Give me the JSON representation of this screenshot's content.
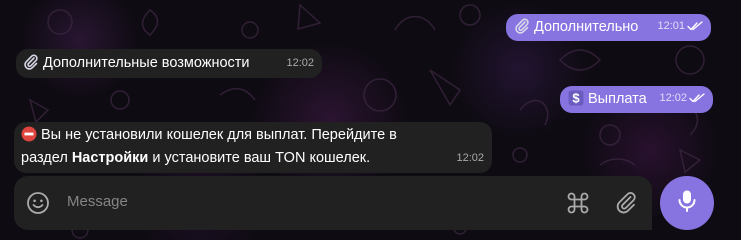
{
  "messages": [
    {
      "id": "m1",
      "direction": "outgoing",
      "icon": "paperclip-emoji-icon",
      "text": "Дополнительно",
      "time": "12:01",
      "read": true
    },
    {
      "id": "m2",
      "direction": "incoming",
      "icon": "paperclip-emoji-icon",
      "text": "Дополнительные возможности",
      "time": "12:02"
    },
    {
      "id": "m3",
      "direction": "outgoing",
      "icon": "dollar-emoji-icon",
      "text": "Выплата",
      "time": "12:02",
      "read": true
    },
    {
      "id": "m4",
      "direction": "incoming",
      "icon": "no-entry-emoji-icon",
      "line1": "Вы не установили кошелек для выплат. Перейдите в",
      "line2_pre": "раздел ",
      "line2_bold": "Настройки",
      "line2_post": " и установите ваш TON кошелек.",
      "time": "12:02"
    }
  ],
  "composer": {
    "placeholder": "Message"
  },
  "colors": {
    "outgoing_bubble": "#8774e1",
    "incoming_bubble": "#212121",
    "background": "#0e0b12",
    "accent": "#8774e1"
  }
}
